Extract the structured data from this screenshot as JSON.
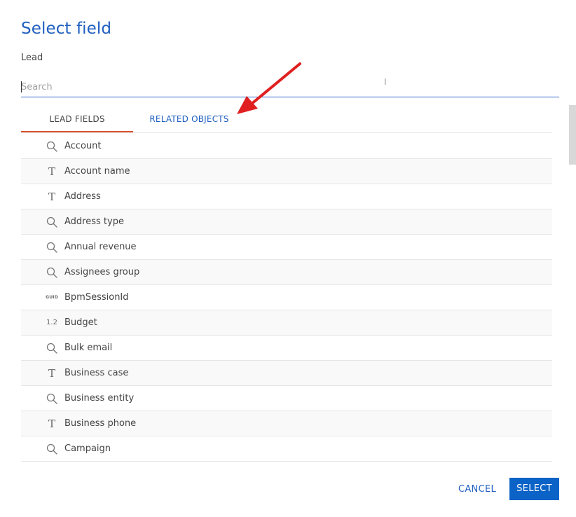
{
  "dialog": {
    "title": "Select field",
    "subtitle": "Lead"
  },
  "search": {
    "placeholder": "Search",
    "value": ""
  },
  "tabs": [
    {
      "label": "LEAD FIELDS",
      "active": true
    },
    {
      "label": "RELATED OBJECTS",
      "active": false
    }
  ],
  "fields": [
    {
      "label": "Account",
      "icon": "lookup-search-icon"
    },
    {
      "label": "Account name",
      "icon": "text-type-icon"
    },
    {
      "label": "Address",
      "icon": "text-type-icon"
    },
    {
      "label": "Address type",
      "icon": "lookup-search-icon"
    },
    {
      "label": "Annual revenue",
      "icon": "lookup-search-icon"
    },
    {
      "label": "Assignees group",
      "icon": "lookup-search-icon"
    },
    {
      "label": "BpmSessionId",
      "icon": "guid-type-icon",
      "icon_text": "GUID"
    },
    {
      "label": "Budget",
      "icon": "decimal-type-icon",
      "icon_text": "1.2"
    },
    {
      "label": "Bulk email",
      "icon": "lookup-search-icon"
    },
    {
      "label": "Business case",
      "icon": "text-type-icon"
    },
    {
      "label": "Business entity",
      "icon": "lookup-search-icon"
    },
    {
      "label": "Business phone",
      "icon": "text-type-icon"
    },
    {
      "label": "Campaign",
      "icon": "lookup-search-icon"
    }
  ],
  "text_icon_glyph": "T",
  "buttons": {
    "cancel": "CANCEL",
    "select": "SELECT"
  },
  "colors": {
    "accent": "#1f5fbf",
    "active_tab_underline": "#d9532c",
    "primary_button": "#0b63c7",
    "annotation_arrow": "#e02020"
  }
}
